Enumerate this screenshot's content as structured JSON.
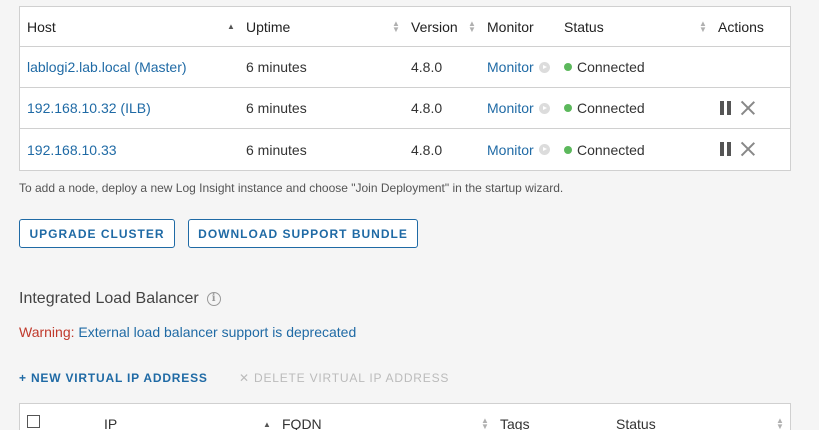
{
  "nodes": {
    "headers": {
      "host": "Host",
      "uptime": "Uptime",
      "version": "Version",
      "monitor": "Monitor",
      "status": "Status",
      "actions": "Actions"
    },
    "rows": [
      {
        "host": "lablogi2.lab.local (Master)",
        "uptime": "6 minutes",
        "version": "4.8.0",
        "monitor": "Monitor",
        "status": "Connected",
        "actions": false
      },
      {
        "host": "192.168.10.32 (ILB)",
        "uptime": "6 minutes",
        "version": "4.8.0",
        "monitor": "Monitor",
        "status": "Connected",
        "actions": true
      },
      {
        "host": "192.168.10.33",
        "uptime": "6 minutes",
        "version": "4.8.0",
        "monitor": "Monitor",
        "status": "Connected",
        "actions": true
      }
    ],
    "hint": "To add a node, deploy a new Log Insight instance and choose \"Join Deployment\" in the startup wizard."
  },
  "buttons": {
    "upgrade": "UPGRADE CLUSTER",
    "download": "DOWNLOAD SUPPORT BUNDLE"
  },
  "ilb": {
    "title": "Integrated Load Balancer",
    "info_icon": "info-icon",
    "warning_label": "Warning:",
    "warning_text": "External load balancer support is deprecated",
    "new_vip": "NEW VIRTUAL IP ADDRESS",
    "delete_vip": "DELETE VIRTUAL IP ADDRESS",
    "table_headers": {
      "ip": "IP",
      "fqdn": "FQDN",
      "tags": "Tags",
      "status": "Status"
    }
  },
  "colors": {
    "link": "#1f6aa5",
    "connected": "#5cb85c",
    "warning": "#c0392b"
  }
}
